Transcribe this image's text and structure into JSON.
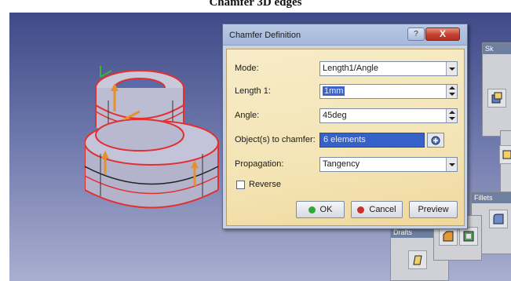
{
  "caption": "Chamfer 3D edges",
  "dialog": {
    "title": "Chamfer Definition",
    "help_label": "?",
    "close_label": "X",
    "mode_label": "Mode:",
    "mode_value": "Length1/Angle",
    "length1_label": "Length 1:",
    "length1_value": "1mm",
    "angle_label": "Angle:",
    "angle_value": "45deg",
    "objects_label": "Object(s) to chamfer:",
    "objects_value": "6 elements",
    "propagation_label": "Propagation:",
    "propagation_value": "Tangency",
    "reverse_label": "Reverse",
    "ok_label": "OK",
    "cancel_label": "Cancel",
    "preview_label": "Preview"
  },
  "toolbars": {
    "top_right_label": "Sk",
    "fillets_label": "Fillets",
    "drafts_label": "Drafts"
  },
  "colors": {
    "ok_green": "#2fa92f",
    "cancel_red": "#c8322a",
    "selection_blue": "#3561c8"
  }
}
